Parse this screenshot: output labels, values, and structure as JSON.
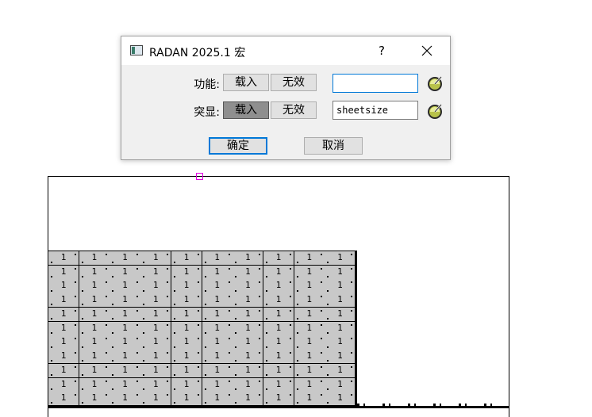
{
  "dialog": {
    "title": "RADAN 2025.1 宏",
    "help": "?",
    "rows": [
      {
        "label": "功能:",
        "load_label": "载入",
        "disable_label": "无效",
        "load_pressed": false,
        "value": "",
        "focused": true
      },
      {
        "label": "突显:",
        "load_label": "载入",
        "disable_label": "无效",
        "load_pressed": true,
        "value": "sheetsize",
        "focused": false
      }
    ],
    "ok_label": "确定",
    "cancel_label": "取消",
    "accent": "#0078d7"
  },
  "canvas": {
    "cell_value": "1",
    "grid_columns": 10,
    "grid_rows": 11,
    "cell_fill": "#c8c8c8",
    "marker_color": "#e000e0"
  }
}
